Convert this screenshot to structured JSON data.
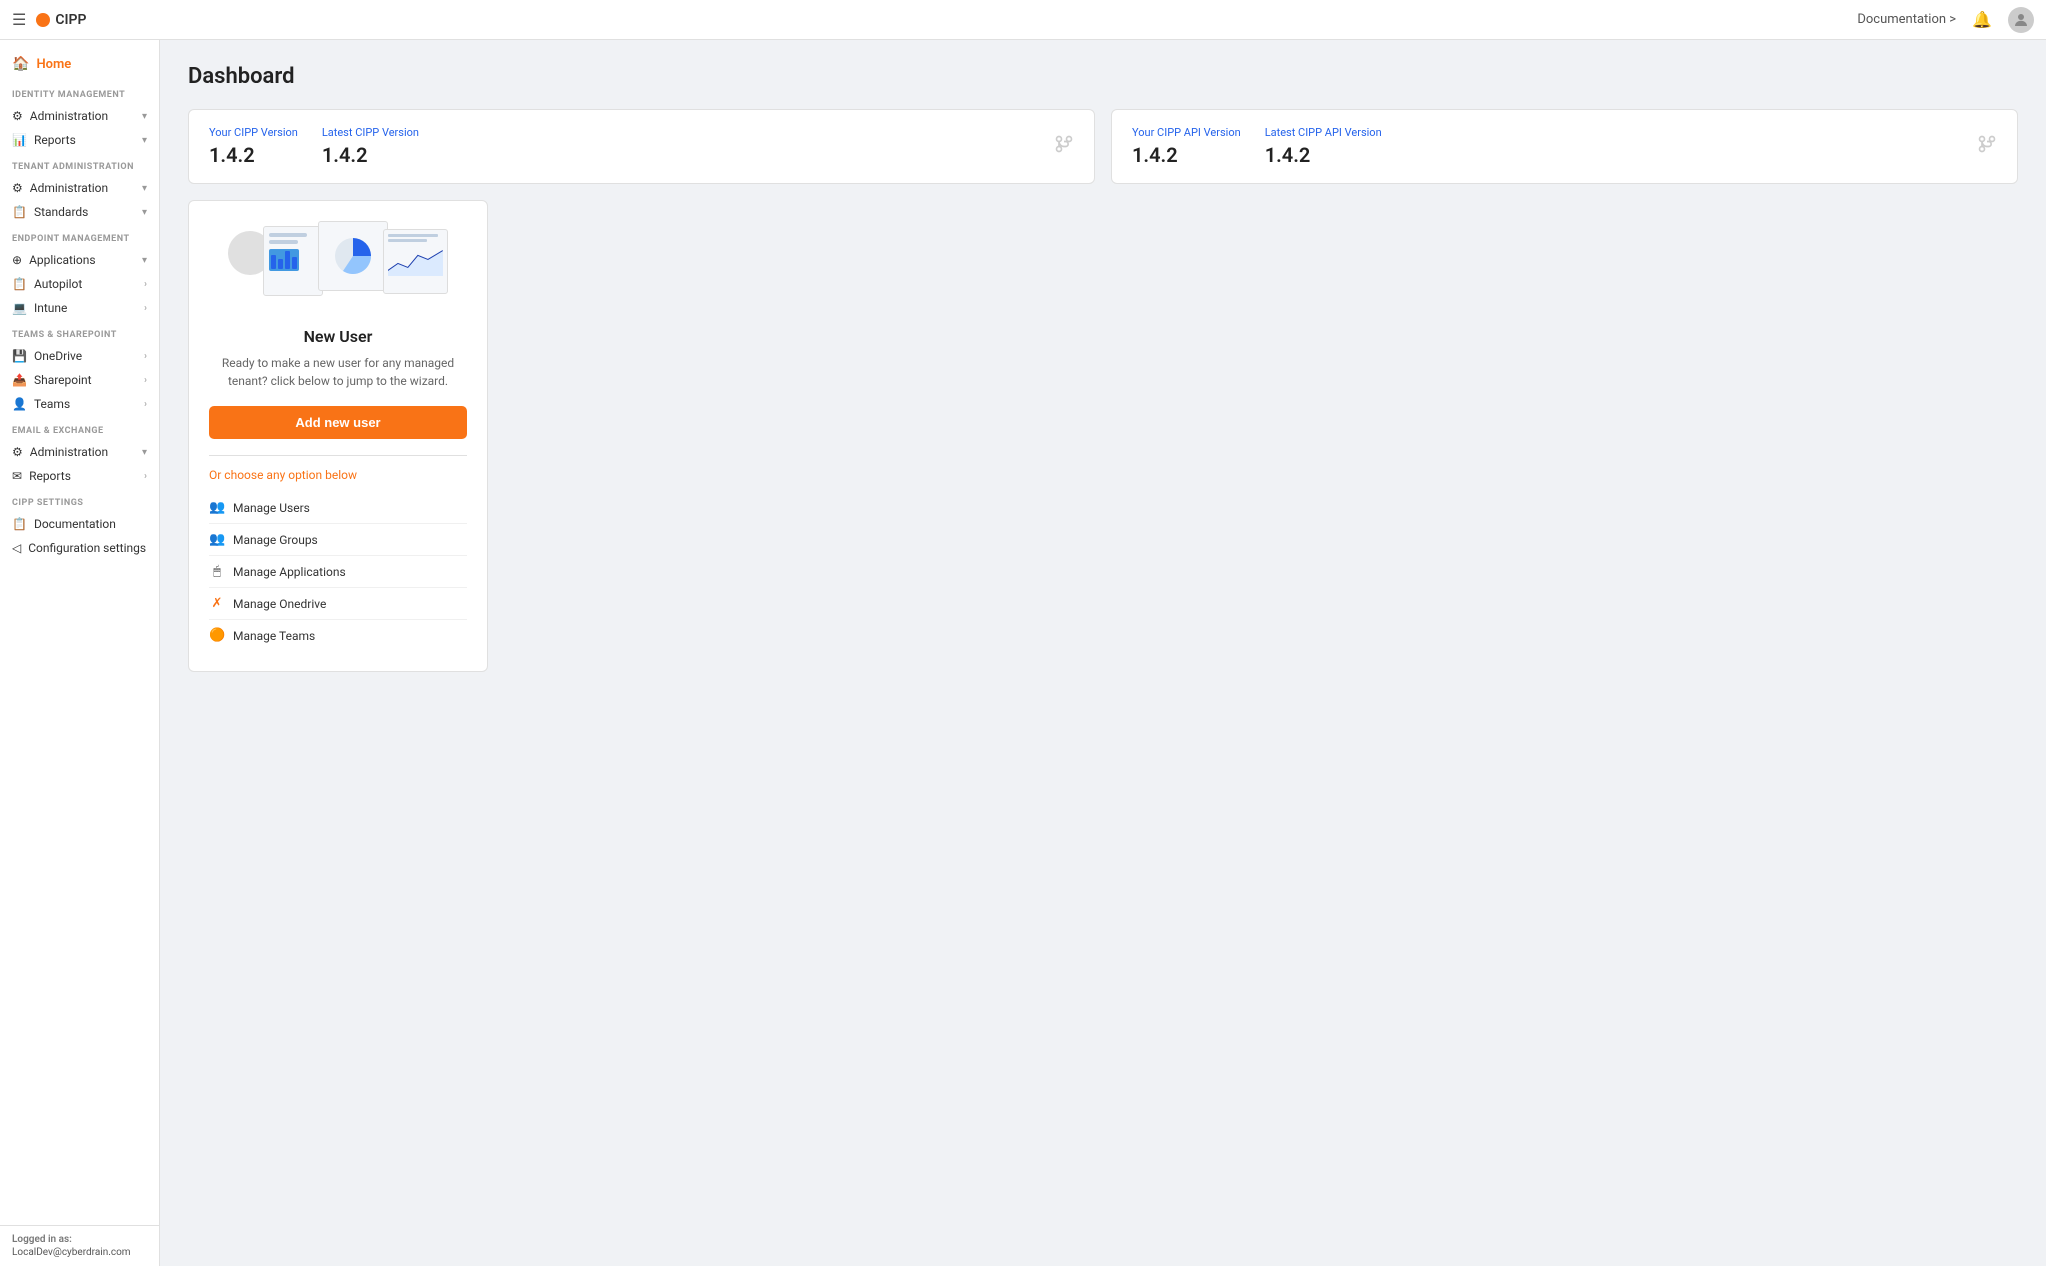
{
  "navbar": {
    "brand": "CIPP",
    "doc_link": "Documentation >",
    "hamburger": "☰"
  },
  "sidebar": {
    "home_label": "Home",
    "sections": [
      {
        "label": "IDENTITY MANAGEMENT",
        "items": [
          {
            "id": "identity-admin",
            "label": "Administration",
            "icon": "⚙",
            "has_chevron": true,
            "chevron": "▾"
          },
          {
            "id": "identity-reports",
            "label": "Reports",
            "icon": "📊",
            "has_chevron": true,
            "chevron": "▾"
          }
        ]
      },
      {
        "label": "TENANT ADMINISTRATION",
        "items": [
          {
            "id": "tenant-admin",
            "label": "Administration",
            "icon": "⚙",
            "has_chevron": true,
            "chevron": "▾"
          },
          {
            "id": "tenant-standards",
            "label": "Standards",
            "icon": "📋",
            "has_chevron": true,
            "chevron": "▾"
          }
        ]
      },
      {
        "label": "ENDPOINT MANAGEMENT",
        "items": [
          {
            "id": "endpoint-applications",
            "label": "Applications",
            "icon": "⊕",
            "has_chevron": true,
            "chevron": "▾"
          },
          {
            "id": "endpoint-autopilot",
            "label": "Autopilot",
            "icon": "📋",
            "has_chevron": true,
            "chevron": "›"
          },
          {
            "id": "endpoint-intune",
            "label": "Intune",
            "icon": "💻",
            "has_chevron": true,
            "chevron": "›"
          }
        ]
      },
      {
        "label": "TEAMS & SHAREPOINT",
        "items": [
          {
            "id": "teams-onedrive",
            "label": "OneDrive",
            "icon": "💾",
            "has_chevron": true,
            "chevron": "›"
          },
          {
            "id": "teams-sharepoint",
            "label": "Sharepoint",
            "icon": "📤",
            "has_chevron": true,
            "chevron": "›"
          },
          {
            "id": "teams-teams",
            "label": "Teams",
            "icon": "👤",
            "has_chevron": true,
            "chevron": "›"
          }
        ]
      },
      {
        "label": "EMAIL & EXCHANGE",
        "items": [
          {
            "id": "email-admin",
            "label": "Administration",
            "icon": "⚙",
            "has_chevron": true,
            "chevron": "▾"
          },
          {
            "id": "email-reports",
            "label": "Reports",
            "icon": "✉",
            "has_chevron": true,
            "chevron": "›"
          }
        ]
      },
      {
        "label": "CIPP SETTINGS",
        "items": [
          {
            "id": "cipp-documentation",
            "label": "Documentation",
            "icon": "📋",
            "has_chevron": false
          },
          {
            "id": "cipp-config",
            "label": "Configuration settings",
            "icon": "◁",
            "has_chevron": false
          }
        ]
      }
    ],
    "footer": {
      "logged_in_as": "Logged in as:",
      "email": "LocalDev@cyberdrain.com"
    }
  },
  "main": {
    "page_title": "Dashboard",
    "version_cards": [
      {
        "your_label": "Your CIPP Version",
        "your_value": "1.4.2",
        "latest_label": "Latest CIPP Version",
        "latest_value": "1.4.2"
      },
      {
        "your_label": "Your CIPP API Version",
        "your_value": "1.4.2",
        "latest_label": "Latest CIPP API Version",
        "latest_value": "1.4.2"
      }
    ],
    "new_user_card": {
      "title": "New User",
      "description": "Ready to make a new user for any managed tenant? click below to jump to the wizard.",
      "button_label": "Add new user",
      "or_choose_label": "Or choose any option below",
      "quick_links": [
        {
          "id": "manage-users",
          "label": "Manage Users",
          "icon": "👥"
        },
        {
          "id": "manage-groups",
          "label": "Manage Groups",
          "icon": "👥"
        },
        {
          "id": "manage-applications",
          "label": "Manage Applications",
          "icon": "🖱"
        },
        {
          "id": "manage-onedrive",
          "label": "Manage Onedrive",
          "icon": "✗"
        },
        {
          "id": "manage-teams",
          "label": "Manage Teams",
          "icon": "🟠"
        }
      ]
    }
  }
}
